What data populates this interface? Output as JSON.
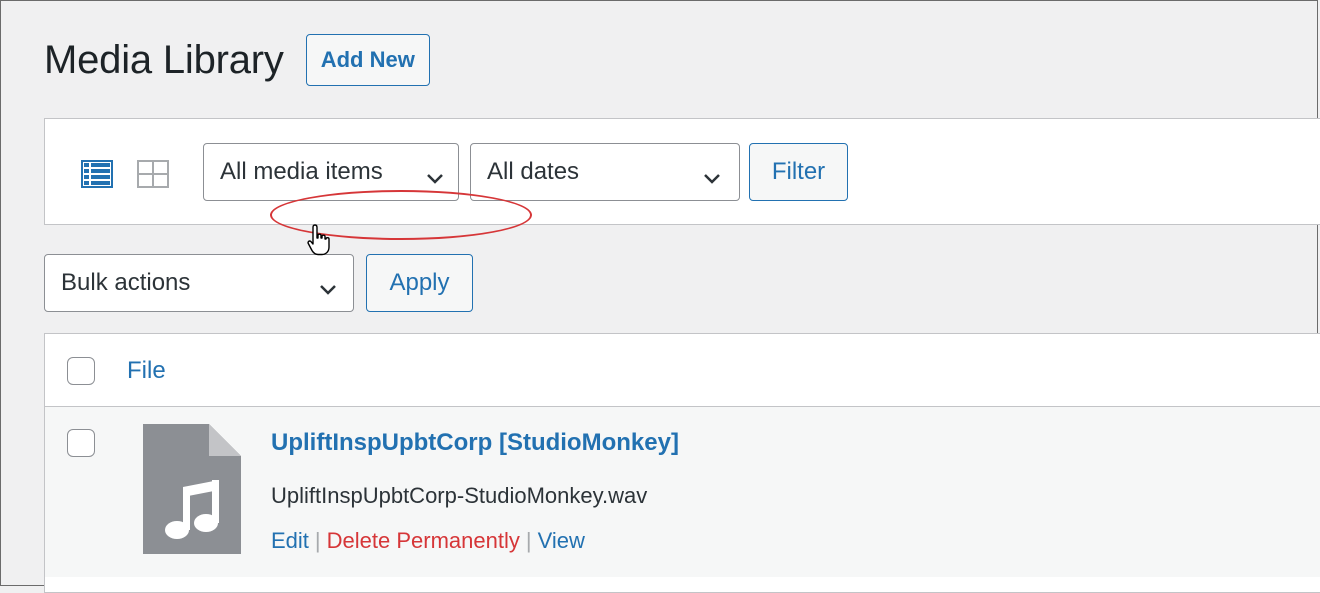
{
  "header": {
    "title": "Media Library",
    "add_new_label": "Add New"
  },
  "filters": {
    "media_type": {
      "selected": "All media items"
    },
    "dates": {
      "selected": "All dates"
    },
    "filter_button": "Filter"
  },
  "bulk": {
    "selected": "Bulk actions",
    "apply_label": "Apply"
  },
  "table": {
    "columns": [
      "File"
    ],
    "rows": [
      {
        "title": "UpliftInspUpbtCorp [StudioMonkey]",
        "filename": "UpliftInspUpbtCorp-StudioMonkey.wav",
        "actions": {
          "edit": "Edit",
          "delete": "Delete Permanently",
          "view": "View"
        }
      }
    ]
  },
  "colors": {
    "accent": "#2271b1",
    "danger": "#d63638",
    "background": "#f0f0f1"
  },
  "icons": [
    "list-view-icon",
    "grid-view-icon",
    "chevron-down-icon",
    "audio-file-icon",
    "hand-pointer-cursor"
  ]
}
